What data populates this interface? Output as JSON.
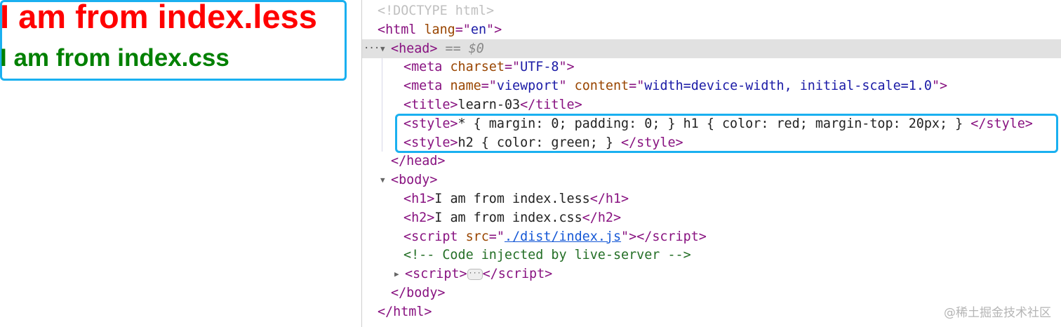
{
  "preview": {
    "h1_text": "I am from index.less",
    "h2_text": "I am from index.css",
    "h1_color": "#ff0000",
    "h2_color": "#008000",
    "highlight_color": "#1ab0f0"
  },
  "elements_tree": {
    "selected_marker": "== $0",
    "lines": [
      {
        "indent": 0,
        "toggle": "",
        "segments": [
          {
            "c": "dt",
            "text": "<!DOCTYPE html>"
          }
        ]
      },
      {
        "indent": 0,
        "toggle": "",
        "segments": [
          {
            "c": "t",
            "text": "<html "
          },
          {
            "c": "an",
            "text": "lang"
          },
          {
            "c": "t",
            "text": "=\""
          },
          {
            "c": "av",
            "text": "en"
          },
          {
            "c": "t",
            "text": "\">"
          }
        ]
      },
      {
        "indent": 1,
        "toggle": "expanded",
        "selected": true,
        "segments": [
          {
            "c": "t",
            "text": "<head>"
          },
          {
            "c": "eq",
            "text": " == "
          },
          {
            "c": "dv",
            "text": "$0"
          }
        ]
      },
      {
        "indent": 2,
        "toggle": "",
        "segments": [
          {
            "c": "t",
            "text": "<meta "
          },
          {
            "c": "an",
            "text": "charset"
          },
          {
            "c": "t",
            "text": "=\""
          },
          {
            "c": "av",
            "text": "UTF-8"
          },
          {
            "c": "t",
            "text": "\">"
          }
        ]
      },
      {
        "indent": 2,
        "toggle": "",
        "segments": [
          {
            "c": "t",
            "text": "<meta "
          },
          {
            "c": "an",
            "text": "name"
          },
          {
            "c": "t",
            "text": "=\""
          },
          {
            "c": "av",
            "text": "viewport"
          },
          {
            "c": "t",
            "text": "\" "
          },
          {
            "c": "an",
            "text": "content"
          },
          {
            "c": "t",
            "text": "=\""
          },
          {
            "c": "av",
            "text": "width=device-width, initial-scale=1.0"
          },
          {
            "c": "t",
            "text": "\">"
          }
        ]
      },
      {
        "indent": 2,
        "toggle": "",
        "segments": [
          {
            "c": "t",
            "text": "<title>"
          },
          {
            "c": "tx",
            "text": "learn-03"
          },
          {
            "c": "t",
            "text": "</title>"
          }
        ]
      },
      {
        "indent": 2,
        "toggle": "",
        "segments": [
          {
            "c": "t",
            "text": "<style>"
          },
          {
            "c": "tx",
            "text": "* { margin: 0; padding: 0; } h1 { color: red; margin-top: 20px; } "
          },
          {
            "c": "t",
            "text": "</style>"
          }
        ]
      },
      {
        "indent": 2,
        "toggle": "",
        "segments": [
          {
            "c": "t",
            "text": "<style>"
          },
          {
            "c": "tx",
            "text": "h2 { color: green; } "
          },
          {
            "c": "t",
            "text": "</style>"
          }
        ]
      },
      {
        "indent": 1,
        "toggle": "",
        "segments": [
          {
            "c": "t",
            "text": "</head>"
          }
        ]
      },
      {
        "indent": 1,
        "toggle": "expanded",
        "segments": [
          {
            "c": "t",
            "text": "<body>"
          }
        ]
      },
      {
        "indent": 2,
        "toggle": "",
        "segments": [
          {
            "c": "t",
            "text": "<h1>"
          },
          {
            "c": "tx",
            "text": "I am from index.less"
          },
          {
            "c": "t",
            "text": "</h1>"
          }
        ]
      },
      {
        "indent": 2,
        "toggle": "",
        "segments": [
          {
            "c": "t",
            "text": "<h2>"
          },
          {
            "c": "tx",
            "text": "I am from index.css"
          },
          {
            "c": "t",
            "text": "</h2>"
          }
        ]
      },
      {
        "indent": 2,
        "toggle": "",
        "segments": [
          {
            "c": "t",
            "text": "<script "
          },
          {
            "c": "an",
            "text": "src"
          },
          {
            "c": "t",
            "text": "=\""
          },
          {
            "c": "lk",
            "text": "./dist/index.js"
          },
          {
            "c": "t",
            "text": "\"></script>"
          }
        ]
      },
      {
        "indent": 2,
        "toggle": "",
        "segments": [
          {
            "c": "cm",
            "text": "<!-- Code injected by live-server -->"
          }
        ]
      },
      {
        "indent": 2,
        "toggle": "collapsed",
        "segments": [
          {
            "c": "t",
            "text": "<script>"
          },
          {
            "c": "ell",
            "text": "···"
          },
          {
            "c": "t",
            "text": "</script>"
          }
        ]
      },
      {
        "indent": 1,
        "toggle": "",
        "segments": [
          {
            "c": "t",
            "text": "</body>"
          }
        ]
      },
      {
        "indent": 0,
        "toggle": "",
        "segments": [
          {
            "c": "t",
            "text": "</html>"
          }
        ]
      }
    ]
  },
  "watermark": "@稀土掘金技术社区"
}
